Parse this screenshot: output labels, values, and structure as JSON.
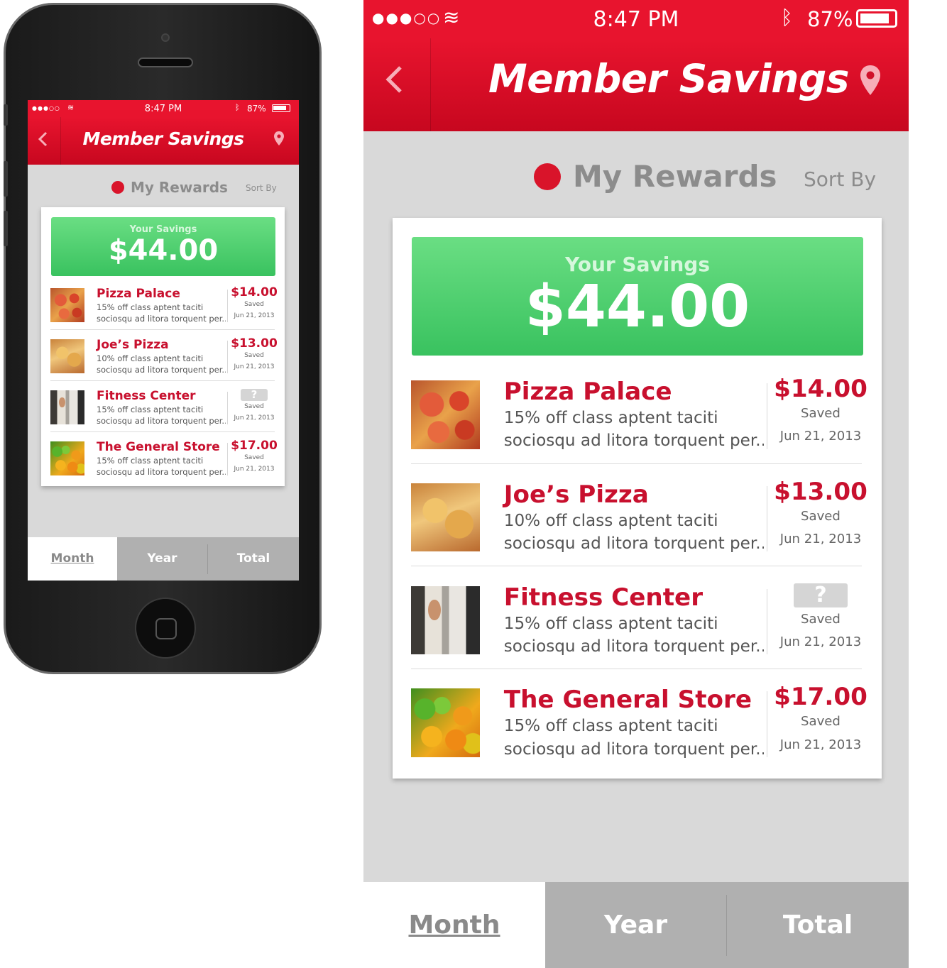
{
  "status": {
    "time": "8:47 PM",
    "battery": "87%"
  },
  "header": {
    "title": "Member Savings"
  },
  "rewards": {
    "title": "My Rewards",
    "sort_by": "Sort By"
  },
  "savings": {
    "label": "Your Savings",
    "amount": "$44.00"
  },
  "items": [
    {
      "name": "Pizza Palace",
      "line1": "15% off class aptent taciti",
      "line2": "sociosqu ad litora torquent per...",
      "price": "$14.00",
      "saved": "Saved",
      "date": "Jun 21, 2013",
      "image": "pizza"
    },
    {
      "name": "Joe’s Pizza",
      "line1": "10% off class aptent taciti",
      "line2": "sociosqu ad litora torquent per...",
      "price": "$13.00",
      "saved": "Saved",
      "date": "Jun 21, 2013",
      "image": "pizza"
    },
    {
      "name": "Fitness Center",
      "line1": "15% off class aptent taciti",
      "line2": "sociosqu ad litora torquent per...",
      "price": "?",
      "saved": "Saved",
      "date": "Jun 21, 2013",
      "image": "fitness"
    },
    {
      "name": "The General Store",
      "line1": "15% off class aptent taciti",
      "line2": "sociosqu ad litora torquent per...",
      "price": "$17.00",
      "saved": "Saved",
      "date": "Jun 21, 2013",
      "image": "produce"
    }
  ],
  "tabs": [
    {
      "label": "Month",
      "active": true
    },
    {
      "label": "Year",
      "active": false
    },
    {
      "label": "Total",
      "active": false
    }
  ],
  "colors": {
    "brand_red": "#e8142e",
    "savings_green": "#3fc462",
    "tab_gray": "#b0b0b0"
  },
  "icons": [
    "signal-dots-icon",
    "wifi-icon",
    "bluetooth-icon",
    "battery-icon",
    "back-chevron-icon",
    "location-pin-icon",
    "smiley-icon",
    "help-question-icon"
  ]
}
